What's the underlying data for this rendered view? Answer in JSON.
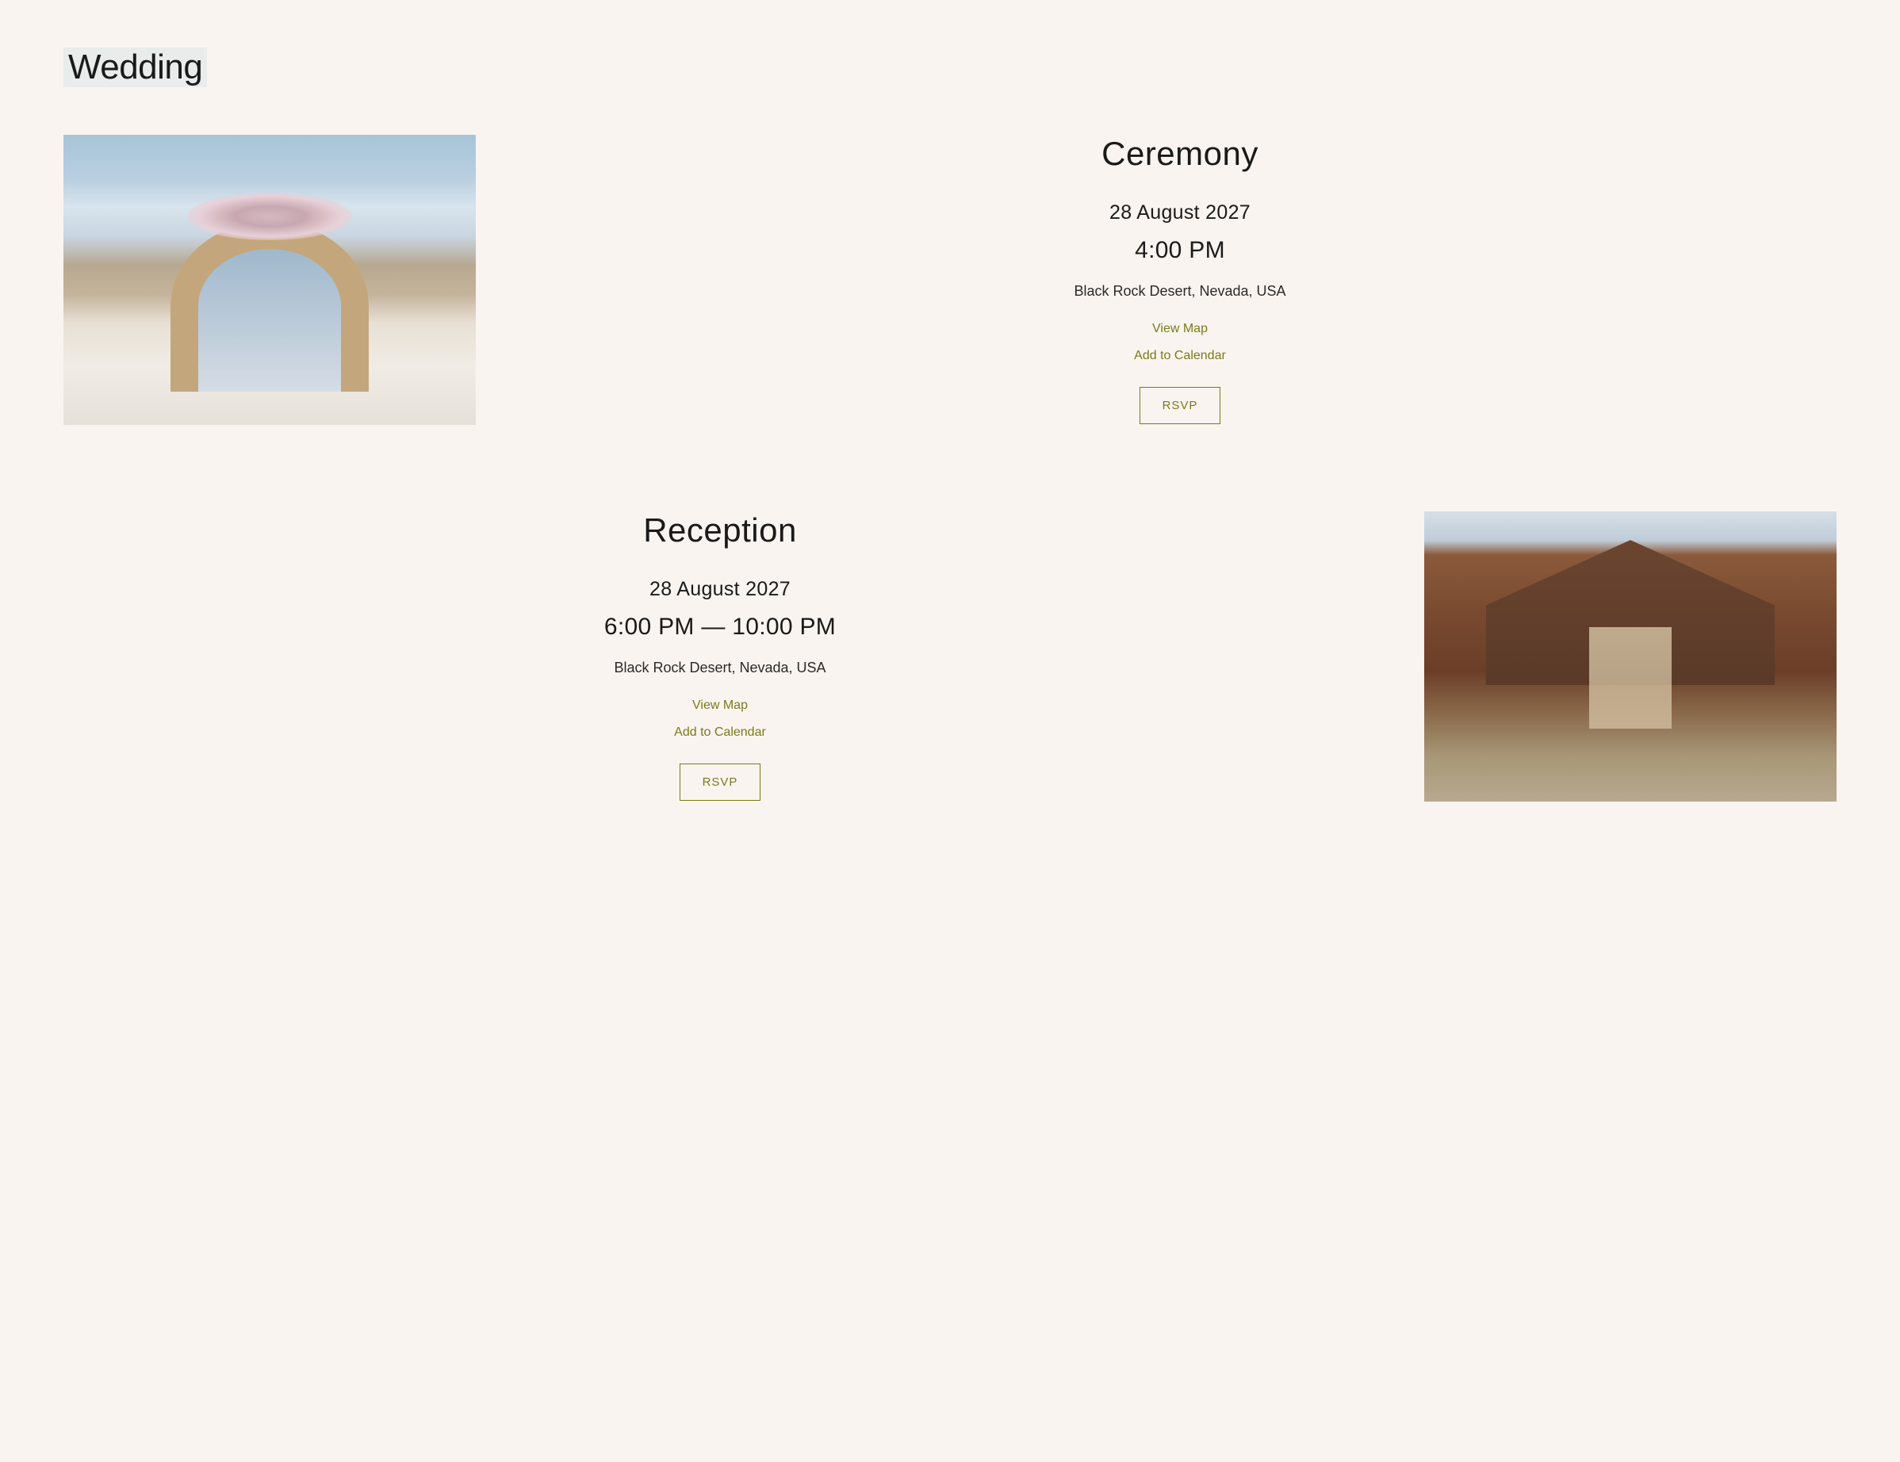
{
  "page_title": "Wedding",
  "events": [
    {
      "title": "Ceremony",
      "date": "28 August 2027",
      "time": "4:00 PM",
      "location": "Black Rock Desert, Nevada, USA",
      "view_map_label": "View Map",
      "add_calendar_label": "Add to Calendar",
      "rsvp_label": "RSVP"
    },
    {
      "title": "Reception",
      "date": "28 August 2027",
      "time": "6:00 PM — 10:00 PM",
      "location": "Black Rock Desert, Nevada, USA",
      "view_map_label": "View Map",
      "add_calendar_label": "Add to Calendar",
      "rsvp_label": "RSVP"
    }
  ],
  "colors": {
    "background": "#faf4f0",
    "accent": "#7a7a1a",
    "title_highlight": "#e8ecea"
  }
}
